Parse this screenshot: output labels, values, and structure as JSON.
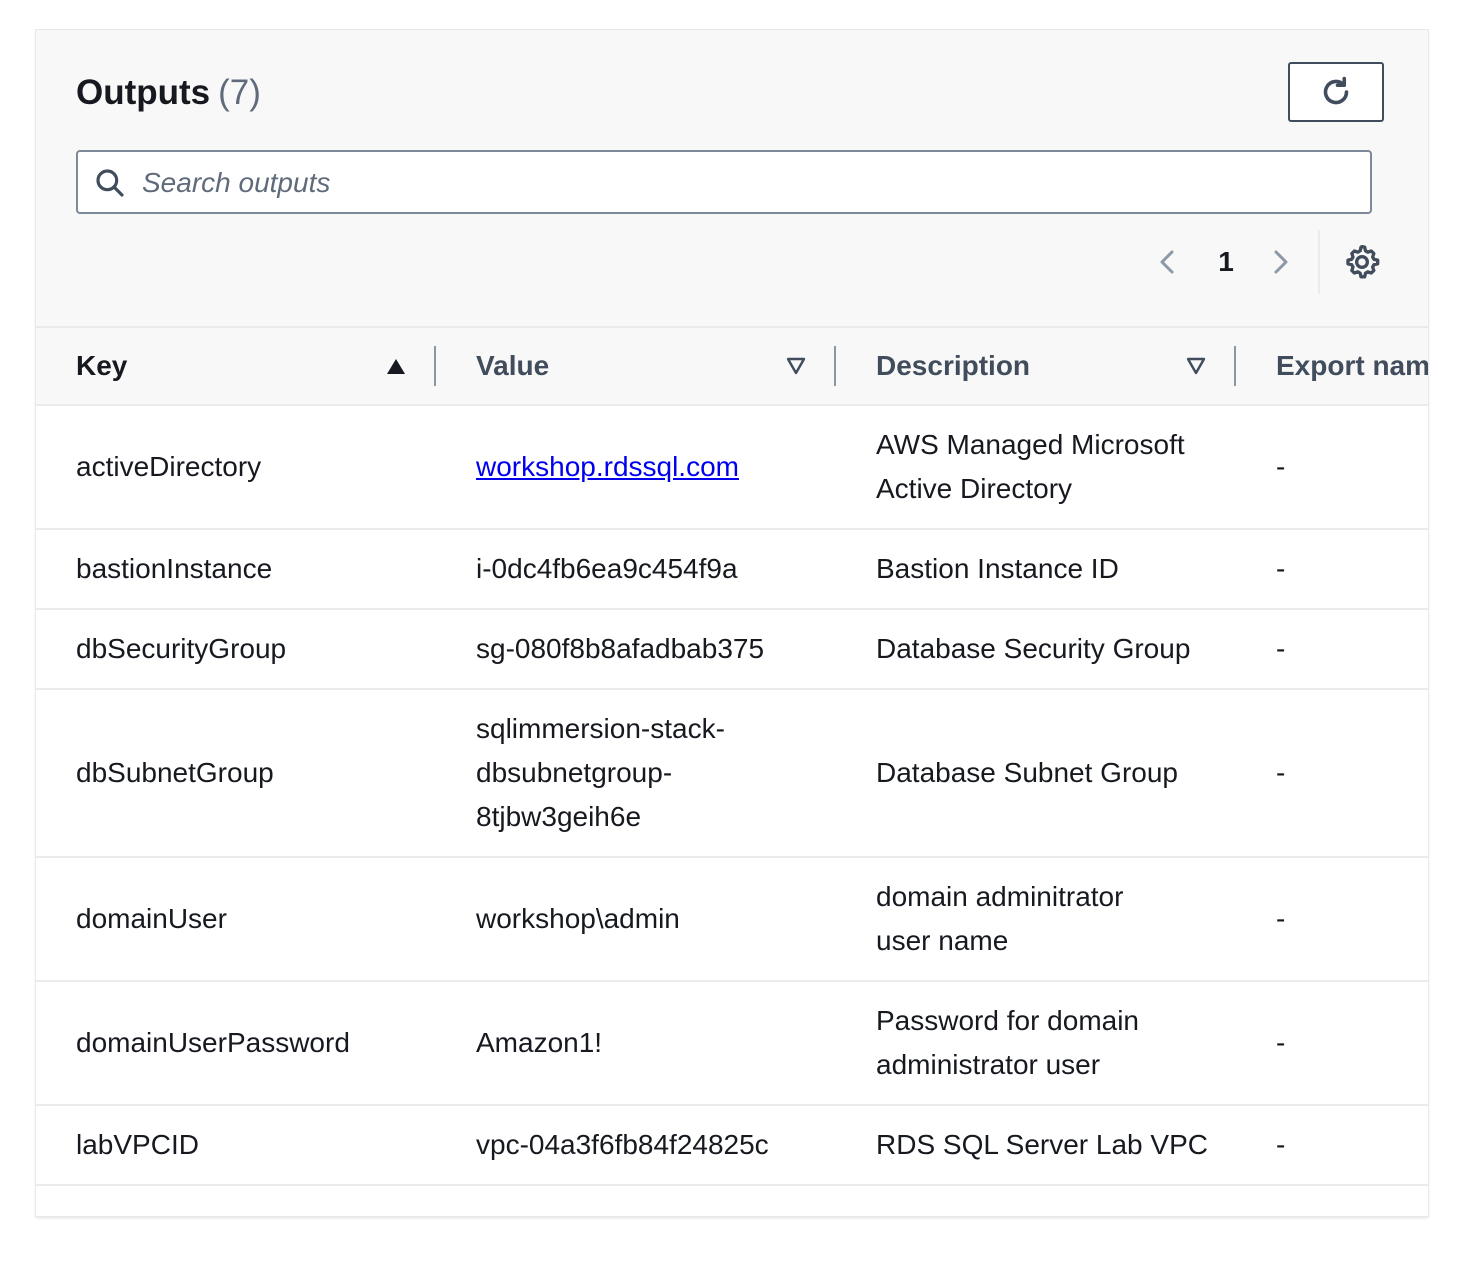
{
  "header": {
    "title": "Outputs",
    "count": "(7)"
  },
  "search": {
    "placeholder": "Search outputs",
    "value": ""
  },
  "pagination": {
    "current_page": "1"
  },
  "icons": {
    "refresh": "refresh-icon",
    "search": "search-icon",
    "prev": "chevron-left-icon",
    "next": "chevron-right-icon",
    "settings": "gear-icon",
    "sort_asc": "caret-up-filled-icon",
    "sort_none": "caret-down-outline-icon"
  },
  "table": {
    "columns": [
      {
        "label": "Key",
        "sort": "ascending"
      },
      {
        "label": "Value",
        "sort": "none"
      },
      {
        "label": "Description",
        "sort": "none"
      },
      {
        "label": "Export nam",
        "sort": "none"
      }
    ],
    "rows": [
      {
        "key": "activeDirectory",
        "value": "workshop.rdssql.com",
        "value_is_link": true,
        "description": "AWS Managed Microsoft Active Directory",
        "export": "-"
      },
      {
        "key": "bastionInstance",
        "value": "i-0dc4fb6ea9c454f9a",
        "value_is_link": false,
        "description": "Bastion Instance ID",
        "export": "-"
      },
      {
        "key": "dbSecurityGroup",
        "value": "sg-080f8b8afadbab375",
        "value_is_link": false,
        "description": "Database Security Group",
        "export": "-"
      },
      {
        "key": "dbSubnetGroup",
        "value": "sqlimmersion-stack-dbsubnetgroup-8tjbw3geih6e",
        "value_is_link": false,
        "description": "Database Subnet Group",
        "export": "-"
      },
      {
        "key": "domainUser",
        "value": "workshop\\admin",
        "value_is_link": false,
        "description": "domain adminitrator user name",
        "export": "-"
      },
      {
        "key": "domainUserPassword",
        "value": "Amazon1!",
        "value_is_link": false,
        "description": "Password for domain administrator user",
        "export": "-"
      },
      {
        "key": "labVPCID",
        "value": "vpc-04a3f6fb84f24825c",
        "value_is_link": false,
        "description": "RDS SQL Server Lab VPC",
        "export": "-"
      }
    ]
  },
  "colors": {
    "text": "#16191f",
    "secondary_text": "#5f6b7a",
    "header_bg": "#f8f8f8",
    "link": "#0000ee",
    "border": "#e9ebed"
  }
}
